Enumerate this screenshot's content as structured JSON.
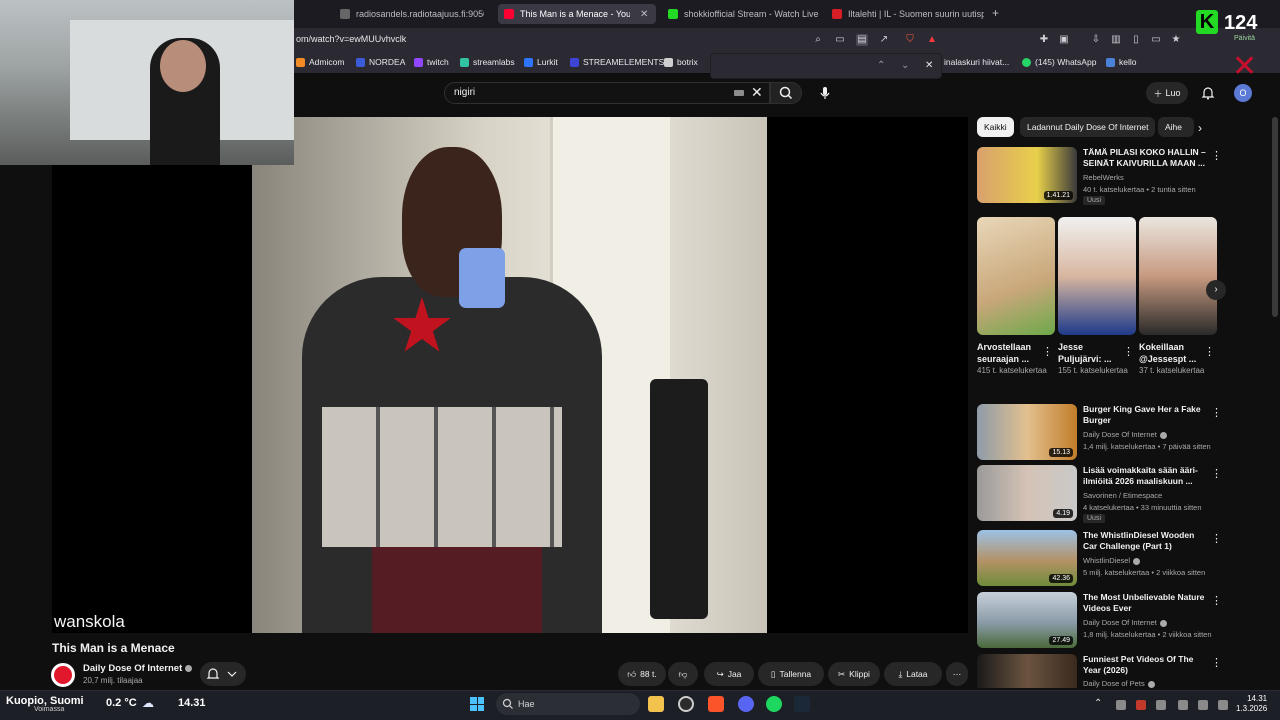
{
  "browser": {
    "tabs": [
      {
        "title": "radiosandels.radiotaajuus.fi:9050",
        "active": false
      },
      {
        "title": "This Man is a Menace - YouTube",
        "active": true
      },
      {
        "title": "shokkiofficial Stream - Watch Live on",
        "active": false
      },
      {
        "title": "Iltalehti | IL - Suomen suurin uutispal",
        "active": false
      }
    ],
    "new_tab": "+",
    "url": "om/watch?v=ewMUUvhvclk",
    "bookmarks": [
      "Admicom",
      "NORDEA",
      "twitch",
      "streamlabs",
      "Lurkit",
      "STREAMELEMENTS",
      "botrix",
      "inalaskuri hiivat...",
      "(145) WhatsApp",
      "kello"
    ],
    "find_prev": "⌃",
    "find_next": "⌄",
    "find_close": "✕"
  },
  "youtube": {
    "search_value": "nigiri",
    "create_label": "Luo",
    "profile_initial": "O",
    "video": {
      "watermark": "wanskola",
      "title": "This Man is a Menace",
      "channel": "Daily Dose Of Internet",
      "subscribers": "20,7 milj. tilaajaa",
      "likes": "88 t.",
      "share": "Jaa",
      "save": "Tallenna",
      "clip": "Klippi",
      "download": "Lataa",
      "more": "⋯"
    },
    "chips": [
      {
        "label": "Kaikki",
        "selected": true
      },
      {
        "label": "Ladannut Daily Dose Of Internet",
        "selected": false
      },
      {
        "label": "Aihe",
        "selected": false
      }
    ],
    "recommendations": [
      {
        "title": "TÄMÄ PILASI KOKO HALLIN – SEINÄT KAIVURILLA MAAN ...",
        "channel": "RebelWerks",
        "meta": "40 t. katselukertaa • 2 tuntia sitten",
        "duration": "1.41.21",
        "badge": "Uusi"
      },
      {
        "title": "Burger King Gave Her a Fake Burger",
        "channel": "Daily Dose Of Internet",
        "meta": "1,4 milj. katselukertaa • 7 päivää sitten",
        "duration": "15.13",
        "badge": ""
      },
      {
        "title": "Lisää voimakkaita sään ääri-ilmiöitä 2026 maaliskuun ...",
        "channel": "Savorinen / Etimespace",
        "meta": "4 katselukertaa • 33 minuuttia sitten",
        "duration": "4.19",
        "badge": "Uusi"
      },
      {
        "title": "The WhistlinDiesel Wooden Car Challenge (Part 1)",
        "channel": "WhistlinDiesel",
        "meta": "5 milj. katselukertaa • 2 viikkoa sitten",
        "duration": "42.36",
        "badge": ""
      },
      {
        "title": "The Most Unbelievable Nature Videos Ever",
        "channel": "Daily Dose Of Internet",
        "meta": "1,8 milj. katselukertaa • 2 viikkoa sitten",
        "duration": "27.49",
        "badge": ""
      },
      {
        "title": "Funniest Pet Videos Of The Year (2026)",
        "channel": "Daily Dose of Pets",
        "meta": "",
        "duration": "",
        "badge": ""
      }
    ],
    "shorts": [
      {
        "title": "Arvostellaan seuraajan ...",
        "views": "415 t. katselukertaa"
      },
      {
        "title": "Jesse Puljujärvi: ...",
        "views": "155 t. katselukertaa"
      },
      {
        "title": "Kokeillaan @Jessespt ...",
        "views": "37 t. katselukertaa"
      }
    ]
  },
  "overlay": {
    "kick_logo": "K",
    "viewer_count": "124",
    "label": "Päivitä"
  },
  "taskbar": {
    "location": "Kuopio, Suomi",
    "weather_sub": "Voimassa",
    "temperature": "0.2 °C",
    "time_widget": "14.31",
    "search_placeholder": "Hae",
    "clock_time": "14.31",
    "clock_date": "1.3.2026"
  },
  "colors": {
    "background": "#0f0f0f",
    "chip_selected": "#f1f1f1",
    "youtube_red": "#e1182c",
    "kick_green": "#23d923"
  }
}
